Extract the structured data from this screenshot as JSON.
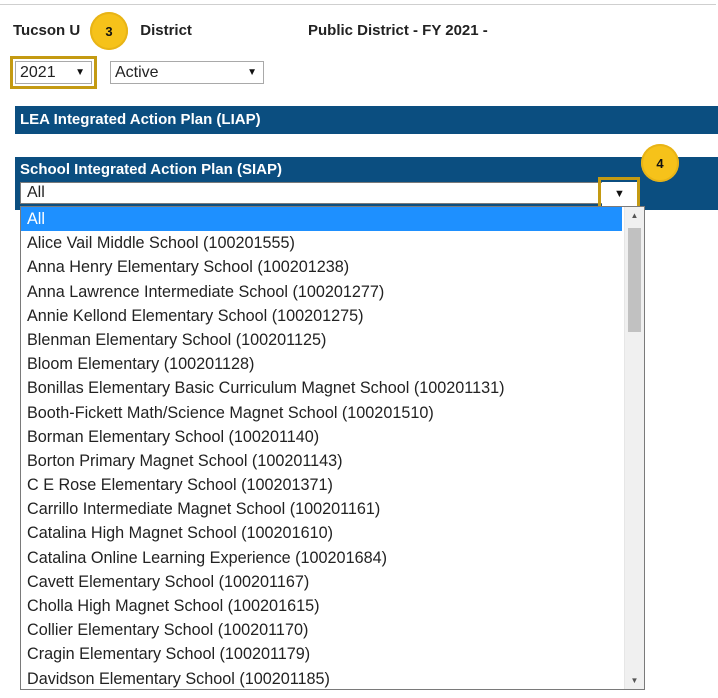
{
  "header": {
    "district_prefix": "Tucson U",
    "district_suffix": "District",
    "fiscal_title": "Public District - FY 2021 -"
  },
  "callouts": {
    "step3": "3",
    "step4": "4"
  },
  "filters": {
    "year": "2021",
    "status": "Active",
    "arrow": "▼"
  },
  "sections": {
    "liap": "LEA Integrated Action Plan (LIAP)",
    "siap": "School Integrated Action Plan (SIAP)"
  },
  "siap_dropdown": {
    "selected": "All",
    "options": [
      "All",
      "Alice Vail Middle School (100201555)",
      "Anna Henry Elementary School (100201238)",
      "Anna Lawrence Intermediate School (100201277)",
      "Annie Kellond Elementary School (100201275)",
      "Blenman Elementary School (100201125)",
      "Bloom Elementary (100201128)",
      "Bonillas Elementary Basic Curriculum Magnet School (100201131)",
      "Booth-Fickett Math/Science Magnet School (100201510)",
      "Borman Elementary School (100201140)",
      "Borton Primary Magnet School (100201143)",
      "C E Rose Elementary School (100201371)",
      "Carrillo Intermediate Magnet School (100201161)",
      "Catalina High Magnet School (100201610)",
      "Catalina Online Learning Experience (100201684)",
      "Cavett Elementary School (100201167)",
      "Cholla High Magnet School (100201615)",
      "Collier Elementary School (100201170)",
      "Cragin Elementary School (100201179)",
      "Davidson Elementary School (100201185)"
    ]
  },
  "scrollbar": {
    "position_fraction": 0.0
  },
  "colors": {
    "section_bar": "#0b4e80",
    "selected_option": "#1e90ff",
    "callout": "#f6c21a",
    "highlight": "#c49a12"
  }
}
